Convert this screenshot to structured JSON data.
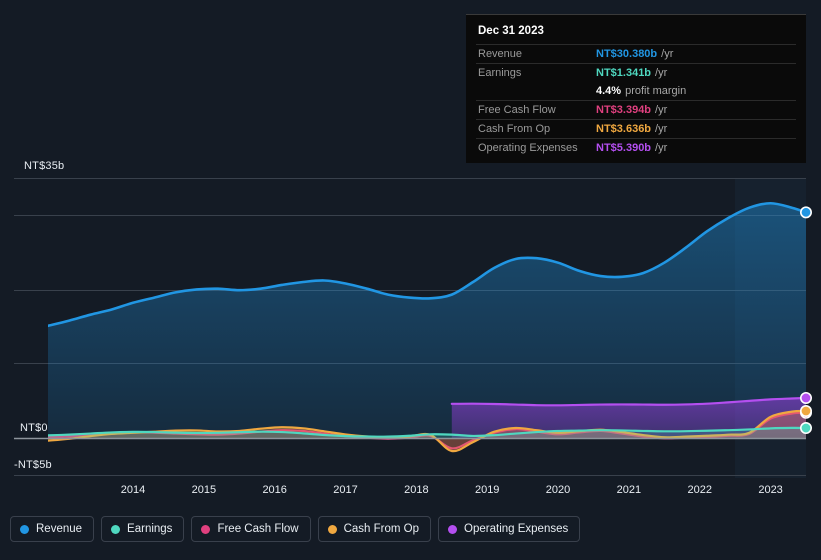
{
  "tooltip": {
    "date": "Dec 31 2023",
    "rows": [
      {
        "label": "Revenue",
        "value": "NT$30.380b",
        "unit": "/yr",
        "color": "#2196e3"
      },
      {
        "label": "Earnings",
        "value": "NT$1.341b",
        "unit": "/yr",
        "color": "#4fd8c0"
      },
      {
        "label": "Free Cash Flow",
        "value": "NT$3.394b",
        "unit": "/yr",
        "color": "#e0407f"
      },
      {
        "label": "Cash From Op",
        "value": "NT$3.636b",
        "unit": "/yr",
        "color": "#f0a840"
      },
      {
        "label": "Operating Expenses",
        "value": "NT$5.390b",
        "unit": "/yr",
        "color": "#b44ff0"
      }
    ],
    "profit_margin_value": "4.4%",
    "profit_margin_label": "profit margin"
  },
  "legend": {
    "items": [
      {
        "label": "Revenue",
        "color": "#2196e3"
      },
      {
        "label": "Earnings",
        "color": "#4fd8c0"
      },
      {
        "label": "Free Cash Flow",
        "color": "#e0407f"
      },
      {
        "label": "Cash From Op",
        "color": "#f0a840"
      },
      {
        "label": "Operating Expenses",
        "color": "#b44ff0"
      }
    ]
  },
  "axis": {
    "y_top_label": "NT$35b",
    "y_zero_label": "NT$0",
    "y_bottom_label": "-NT$5b",
    "x_labels": [
      "2014",
      "2015",
      "2016",
      "2017",
      "2018",
      "2019",
      "2020",
      "2021",
      "2022",
      "2023"
    ]
  },
  "chart_data": {
    "type": "area",
    "title": "",
    "xlabel": "",
    "ylabel": "NT$",
    "ylim": [
      -5,
      35
    ],
    "y_ticks": [
      35,
      30,
      20,
      10,
      0,
      -5
    ],
    "y_tick_labels": [
      "NT$35b",
      "",
      "",
      "",
      "NT$0",
      "-NT$5b"
    ],
    "grid": true,
    "legend_position": "bottom",
    "x": [
      2013.3,
      2013.6,
      2013.9,
      2014.2,
      2014.5,
      2014.8,
      2015.1,
      2015.4,
      2015.7,
      2016.0,
      2016.3,
      2016.6,
      2016.9,
      2017.2,
      2017.5,
      2017.8,
      2018.1,
      2018.4,
      2018.7,
      2019.0,
      2019.3,
      2019.6,
      2019.9,
      2020.2,
      2020.5,
      2020.8,
      2021.1,
      2021.4,
      2021.7,
      2022.0,
      2022.3,
      2022.6,
      2022.9,
      2023.2,
      2023.5,
      2023.8,
      2024.0
    ],
    "series": [
      {
        "name": "Revenue",
        "color": "#2196e3",
        "values": [
          15.1,
          15.8,
          16.6,
          17.3,
          18.2,
          18.9,
          19.6,
          20.0,
          20.1,
          19.9,
          20.1,
          20.6,
          21.0,
          21.2,
          20.8,
          20.1,
          19.3,
          18.9,
          18.8,
          19.3,
          21.0,
          22.9,
          24.1,
          24.2,
          23.6,
          22.5,
          21.8,
          21.7,
          22.2,
          23.6,
          25.6,
          27.8,
          29.6,
          31.0,
          31.6,
          31.0,
          30.38
        ]
      },
      {
        "name": "Earnings",
        "color": "#4fd8c0",
        "values": [
          0.35,
          0.45,
          0.6,
          0.75,
          0.82,
          0.8,
          0.72,
          0.68,
          0.7,
          0.78,
          0.85,
          0.8,
          0.62,
          0.4,
          0.25,
          0.2,
          0.18,
          0.3,
          0.5,
          0.45,
          0.28,
          0.38,
          0.6,
          0.8,
          0.95,
          1.0,
          1.05,
          1.02,
          0.95,
          0.9,
          0.92,
          0.98,
          1.05,
          1.15,
          1.3,
          1.36,
          1.341
        ]
      },
      {
        "name": "Free Cash Flow",
        "color": "#e0407f",
        "values": [
          0.1,
          0.2,
          0.45,
          0.7,
          0.78,
          0.72,
          0.6,
          0.5,
          0.45,
          0.6,
          0.85,
          1.05,
          0.95,
          0.6,
          0.25,
          0.05,
          -0.1,
          0.05,
          0.28,
          -1.4,
          -0.3,
          0.7,
          1.2,
          0.85,
          0.5,
          0.75,
          0.95,
          0.6,
          0.2,
          -0.05,
          0.05,
          0.15,
          0.3,
          0.55,
          2.6,
          3.3,
          3.394
        ]
      },
      {
        "name": "Cash From Op",
        "color": "#f0a840",
        "values": [
          -0.35,
          -0.1,
          0.25,
          0.55,
          0.7,
          0.85,
          1.0,
          1.02,
          0.88,
          0.95,
          1.25,
          1.45,
          1.3,
          0.9,
          0.48,
          0.2,
          0.05,
          0.22,
          0.42,
          -1.75,
          -0.55,
          0.85,
          1.35,
          1.05,
          0.7,
          0.92,
          1.12,
          0.8,
          0.4,
          0.1,
          0.18,
          0.3,
          0.45,
          0.7,
          2.85,
          3.55,
          3.636
        ]
      },
      {
        "name": "Operating Expenses",
        "color": "#b44ff0",
        "values": [
          null,
          null,
          null,
          null,
          null,
          null,
          null,
          null,
          null,
          null,
          null,
          null,
          null,
          null,
          null,
          null,
          null,
          null,
          null,
          4.6,
          4.62,
          4.58,
          4.5,
          4.42,
          4.4,
          4.45,
          4.5,
          4.52,
          4.5,
          4.48,
          4.52,
          4.62,
          4.8,
          5.0,
          5.2,
          5.32,
          5.39
        ]
      }
    ]
  }
}
